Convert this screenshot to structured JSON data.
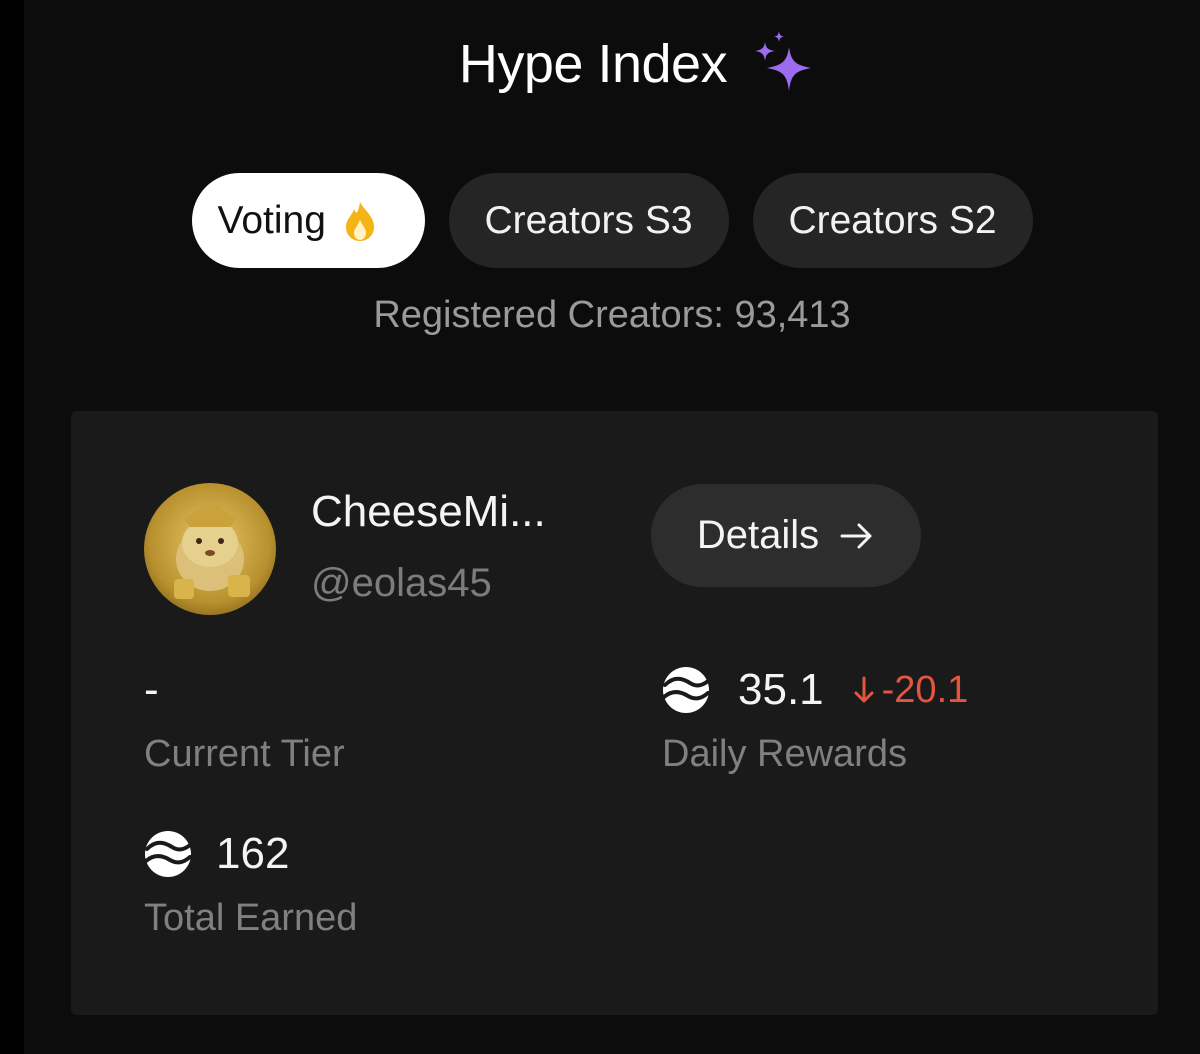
{
  "header": {
    "title": "Hype Index",
    "title_icon": "sparkles-icon",
    "sparkle_color": "#9b6cf0"
  },
  "tabs": [
    {
      "label": "Voting",
      "icon": "flame-icon",
      "active": true
    },
    {
      "label": "Creators S3",
      "active": false
    },
    {
      "label": "Creators S2",
      "active": false
    }
  ],
  "registered_creators": "Registered Creators: 93,413",
  "profile": {
    "display_name": "CheeseMi...",
    "handle": "@eolas45",
    "avatar_icon": "hamster-avatar",
    "details_label": "Details",
    "details_icon": "arrow-right-icon"
  },
  "stats": {
    "current_tier": {
      "value": "-",
      "label": "Current Tier"
    },
    "daily_rewards": {
      "value": "35.1",
      "delta": "-20.1",
      "delta_icon": "arrow-down-icon",
      "label": "Daily Rewards",
      "icon": "coin-icon"
    },
    "total_earned": {
      "value": "162",
      "label": "Total Earned",
      "icon": "coin-icon"
    }
  },
  "colors": {
    "background": "#0c0c0c",
    "card": "#1a1a1a",
    "active_tab": "#ffffff",
    "negative": "#e4553f"
  }
}
